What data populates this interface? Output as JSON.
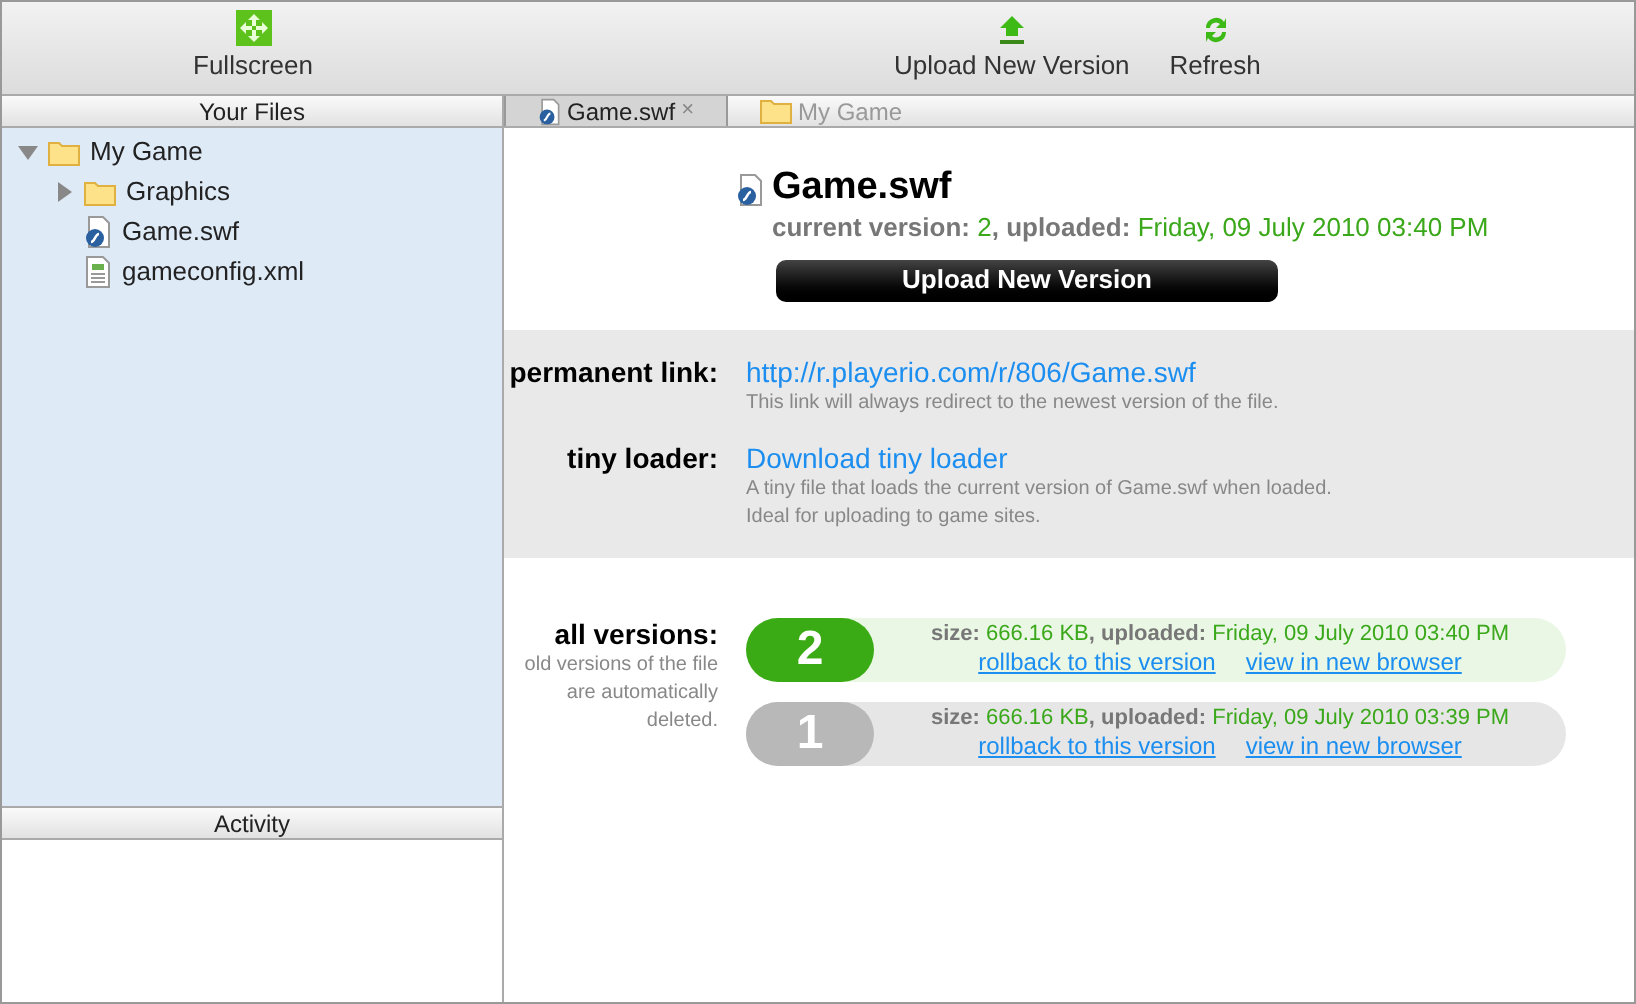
{
  "toolbar": {
    "left": [
      {
        "label": "Fullscreen",
        "kind": "fullscreen"
      }
    ],
    "right": [
      {
        "label": "Upload New Version",
        "kind": "upload"
      },
      {
        "label": "Refresh",
        "kind": "refresh"
      }
    ]
  },
  "sidebar": {
    "title": "Your Files",
    "tree": [
      {
        "label": "My Game",
        "kind": "folder",
        "expanded": true,
        "children": [
          {
            "label": "Graphics",
            "kind": "folder",
            "expanded": false
          },
          {
            "label": "Game.swf",
            "kind": "swf"
          },
          {
            "label": "gameconfig.xml",
            "kind": "xml"
          }
        ]
      }
    ],
    "activity_title": "Activity"
  },
  "tabs": [
    {
      "label": "Game.swf",
      "kind": "swf",
      "selected": true,
      "close": "×"
    },
    {
      "label": "My Game",
      "kind": "folder",
      "selected": false
    }
  ],
  "file": {
    "name": "Game.swf",
    "version_label": "current version:",
    "version": "2",
    "uploaded_label": ", uploaded:",
    "uploaded": "Friday, 09 July 2010 03:40 PM",
    "button": "Upload New Version"
  },
  "links": [
    {
      "label": "permanent link:",
      "link": "http://r.playerio.com/r/806/Game.swf",
      "notes": [
        "This link will always redirect to the newest version of the file."
      ]
    },
    {
      "label": "tiny loader:",
      "link": "Download tiny loader",
      "notes": [
        "A tiny file that loads the current version of Game.swf when loaded.",
        "Ideal for uploading to game sites."
      ]
    }
  ],
  "versions": {
    "label": "all versions:",
    "note": "old versions of the file are automatically deleted.",
    "items": [
      {
        "number": "2",
        "current": true,
        "size_label": "size:",
        "size": "666.16 KB",
        "uploaded_label": ", uploaded:",
        "uploaded": "Friday, 09 July 2010 03:40 PM",
        "rollback": "rollback to this version",
        "view": "view in new browser"
      },
      {
        "number": "1",
        "current": false,
        "size_label": "size:",
        "size": "666.16 KB",
        "uploaded_label": ", uploaded:",
        "uploaded": "Friday, 09 July 2010 03:39 PM",
        "rollback": "rollback to this version",
        "view": "view in new browser"
      }
    ]
  }
}
